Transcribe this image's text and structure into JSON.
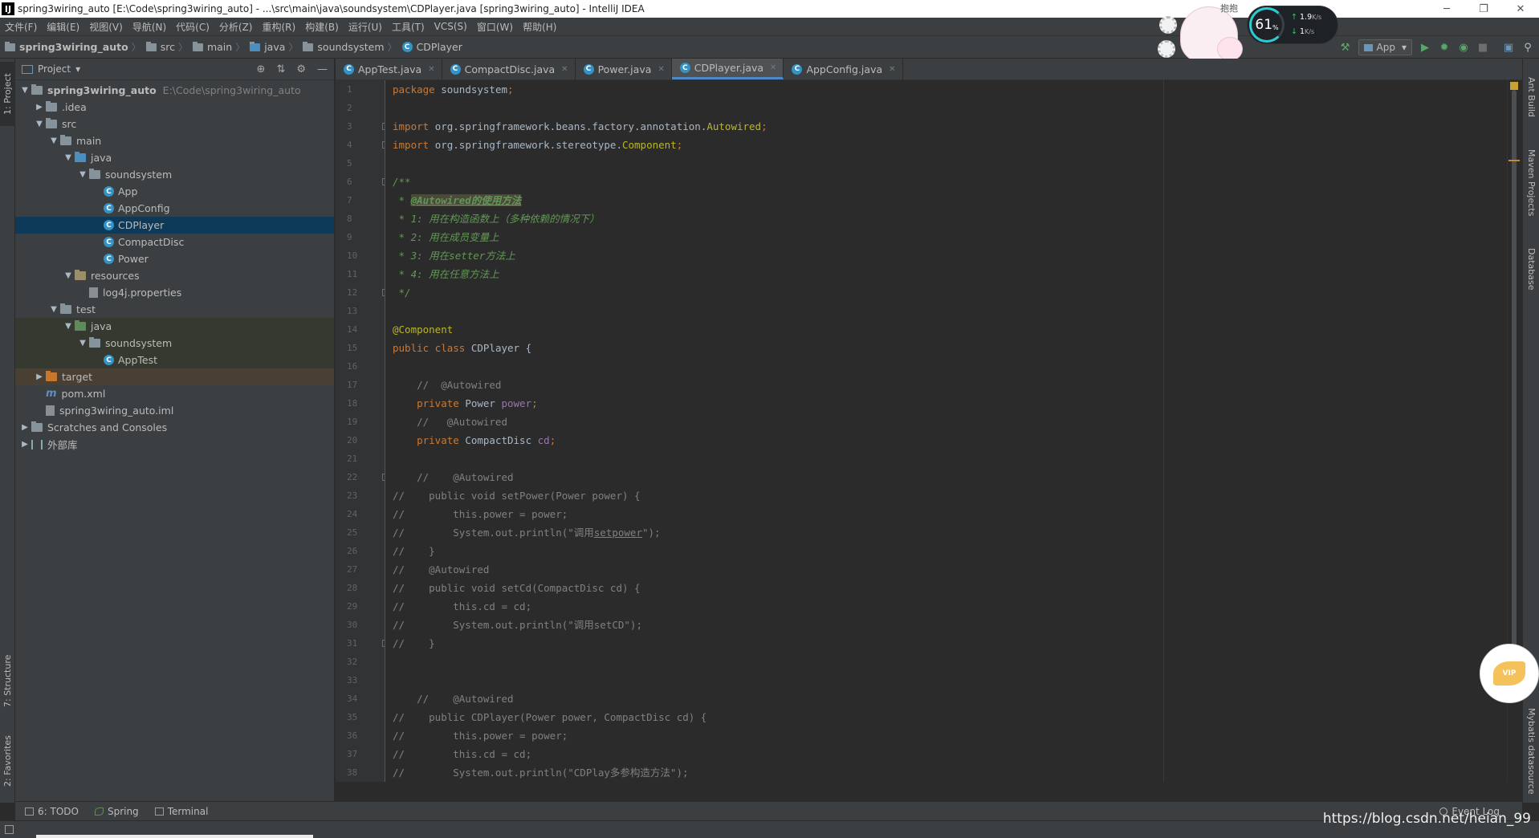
{
  "window": {
    "app_icon": "IJ",
    "title": "spring3wiring_auto [E:\\Code\\spring3wiring_auto] - ...\\src\\main\\java\\soundsystem\\CDPlayer.java [spring3wiring_auto] - IntelliJ IDEA",
    "minimize": "─",
    "restore": "❐",
    "close": "✕"
  },
  "menu": [
    "文件(F)",
    "编辑(E)",
    "视图(V)",
    "导航(N)",
    "代码(C)",
    "分析(Z)",
    "重构(R)",
    "构建(B)",
    "运行(U)",
    "工具(T)",
    "VCS(S)",
    "窗口(W)",
    "帮助(H)"
  ],
  "breadcrumbs": {
    "project": "spring3wiring_auto",
    "src": "src",
    "main": "main",
    "java": "java",
    "package": "soundsystem",
    "class": "CDPlayer",
    "sep": "〉",
    "class_icon": "C"
  },
  "toolbar": {
    "run_config": "App",
    "run_config_arrow": "▾",
    "build_icon": "hammer-icon",
    "run_icon": "▶",
    "debug_icon": "✹",
    "coverage_icon": "◉",
    "stop_icon": "■",
    "structure_icon": "▣",
    "search_icon": "⚲"
  },
  "overlay": {
    "mascot_label": "抱抱",
    "cpu_percent": "61",
    "cpu_unit": "%",
    "upload": "1.9",
    "upload_unit": "K/s",
    "download": "1",
    "download_unit": "K/s",
    "up_arrow": "↑",
    "down_arrow": "↓"
  },
  "left_strip": {
    "project_tab": "1: Project",
    "structure_tab": "7: Structure",
    "favorites_tab": "2: Favorites"
  },
  "right_strip": {
    "ant_build": "Ant Build",
    "maven": "Maven Projects",
    "database": "Database",
    "mybatis": "Mybatis datasource"
  },
  "project_panel": {
    "title": "Project",
    "title_arrow": "▾",
    "tools": [
      "⊕",
      "⇅",
      "⚙",
      "—"
    ],
    "tree": [
      {
        "label": "spring3wiring_auto",
        "path": "E:\\Code\\spring3wiring_auto",
        "depth": 0,
        "arrow": "▼",
        "icon": "module",
        "bold": true
      },
      {
        "label": ".idea",
        "depth": 1,
        "arrow": "▶",
        "icon": "folder"
      },
      {
        "label": "src",
        "depth": 1,
        "arrow": "▼",
        "icon": "folder"
      },
      {
        "label": "main",
        "depth": 2,
        "arrow": "▼",
        "icon": "folder"
      },
      {
        "label": "java",
        "depth": 3,
        "arrow": "▼",
        "icon": "src"
      },
      {
        "label": "soundsystem",
        "depth": 4,
        "arrow": "▼",
        "icon": "package"
      },
      {
        "label": "App",
        "depth": 5,
        "icon": "class"
      },
      {
        "label": "AppConfig",
        "depth": 5,
        "icon": "class"
      },
      {
        "label": "CDPlayer",
        "depth": 5,
        "icon": "class",
        "selected": true
      },
      {
        "label": "CompactDisc",
        "depth": 5,
        "icon": "class"
      },
      {
        "label": "Power",
        "depth": 5,
        "icon": "class"
      },
      {
        "label": "resources",
        "depth": 3,
        "arrow": "▼",
        "icon": "res"
      },
      {
        "label": "log4j.properties",
        "depth": 4,
        "icon": "file"
      },
      {
        "label": "test",
        "depth": 2,
        "arrow": "▼",
        "icon": "folder"
      },
      {
        "label": "java",
        "depth": 3,
        "arrow": "▼",
        "icon": "test",
        "tint": true
      },
      {
        "label": "soundsystem",
        "depth": 4,
        "arrow": "▼",
        "icon": "package",
        "tint": true
      },
      {
        "label": "AppTest",
        "depth": 5,
        "icon": "class",
        "tint": true
      },
      {
        "label": "target",
        "depth": 1,
        "arrow": "▶",
        "icon": "target",
        "excluded": true
      },
      {
        "label": "pom.xml",
        "depth": 1,
        "icon": "maven"
      },
      {
        "label": "spring3wiring_auto.iml",
        "depth": 1,
        "icon": "file"
      },
      {
        "label": "Scratches and Consoles",
        "depth": 0,
        "arrow": "▶",
        "icon": "folder"
      },
      {
        "label": "外部库",
        "depth": 0,
        "arrow": "▶",
        "icon": "lib"
      }
    ]
  },
  "editor_tabs": [
    {
      "label": "AppTest.java",
      "active": false
    },
    {
      "label": "CompactDisc.java",
      "active": false
    },
    {
      "label": "Power.java",
      "active": false
    },
    {
      "label": "CDPlayer.java",
      "active": true
    },
    {
      "label": "AppConfig.java",
      "active": false
    }
  ],
  "tab_close": "✕",
  "code_lines": [
    [
      {
        "t": "package ",
        "c": "kw"
      },
      {
        "t": "soundsystem"
      },
      {
        "t": ";",
        "c": "kw"
      }
    ],
    [],
    [
      {
        "t": "import ",
        "c": "kw"
      },
      {
        "t": "org.springframework.beans.factory.annotation."
      },
      {
        "t": "Autowired",
        "c": "an"
      },
      {
        "t": ";",
        "c": "kw"
      }
    ],
    [
      {
        "t": "import ",
        "c": "kw"
      },
      {
        "t": "org.springframework.stereotype."
      },
      {
        "t": "Component",
        "c": "an"
      },
      {
        "t": ";",
        "c": "kw"
      }
    ],
    [],
    [
      {
        "t": "/**",
        "c": "doc"
      }
    ],
    [
      {
        "t": " * ",
        "c": "doc"
      },
      {
        "t": "@Autowired",
        "c": "doctag"
      },
      {
        "t": "的使用方法",
        "c": "doctag"
      }
    ],
    [
      {
        "t": " * 1: ",
        "c": "doc"
      },
      {
        "t": "用在构造函数上（多种依赖的情况下）",
        "c": "doc"
      }
    ],
    [
      {
        "t": " * 2: ",
        "c": "doc"
      },
      {
        "t": "用在成员变量上",
        "c": "doc"
      }
    ],
    [
      {
        "t": " * 3: ",
        "c": "doc"
      },
      {
        "t": "用在",
        "c": "doc"
      },
      {
        "t": "setter",
        "c": "doc"
      },
      {
        "t": "方法上",
        "c": "doc"
      }
    ],
    [
      {
        "t": " * 4: ",
        "c": "doc"
      },
      {
        "t": "用在任意方法上",
        "c": "doc"
      }
    ],
    [
      {
        "t": " */",
        "c": "doc"
      }
    ],
    [],
    [
      {
        "t": "@Component",
        "c": "an"
      }
    ],
    [
      {
        "t": "public class ",
        "c": "kw"
      },
      {
        "t": "CDPlayer {"
      }
    ],
    [],
    [
      {
        "t": "    //  @Autowired",
        "c": "cm"
      }
    ],
    [
      {
        "t": "    private ",
        "c": "kw"
      },
      {
        "t": "Power "
      },
      {
        "t": "power",
        "c": "fld"
      },
      {
        "t": ";",
        "c": "kw"
      }
    ],
    [
      {
        "t": "    //   @Autowired",
        "c": "cm"
      }
    ],
    [
      {
        "t": "    private ",
        "c": "kw"
      },
      {
        "t": "CompactDisc "
      },
      {
        "t": "cd",
        "c": "fld"
      },
      {
        "t": ";",
        "c": "kw"
      }
    ],
    [],
    [
      {
        "t": "    //    @Autowired",
        "c": "cm"
      }
    ],
    [
      {
        "t": "//    public void setPower(Power power) {",
        "c": "cm"
      }
    ],
    [
      {
        "t": "//        this.power = power;",
        "c": "cm"
      }
    ],
    [
      {
        "t": "//        System.out.println(\"调用",
        "c": "cm"
      },
      {
        "t": "setpower",
        "c": "cm ul"
      },
      {
        "t": "\");",
        "c": "cm"
      }
    ],
    [
      {
        "t": "//    }",
        "c": "cm"
      }
    ],
    [
      {
        "t": "//    @Autowired",
        "c": "cm"
      }
    ],
    [
      {
        "t": "//    public void setCd(CompactDisc cd) {",
        "c": "cm"
      }
    ],
    [
      {
        "t": "//        this.cd = cd;",
        "c": "cm"
      }
    ],
    [
      {
        "t": "//        System.out.println(\"调用setCD\");",
        "c": "cm"
      }
    ],
    [
      {
        "t": "//    }",
        "c": "cm"
      }
    ],
    [],
    [],
    [
      {
        "t": "    //    @Autowired",
        "c": "cm"
      }
    ],
    [
      {
        "t": "//    public CDPlayer(Power power, CompactDisc cd) {",
        "c": "cm"
      }
    ],
    [
      {
        "t": "//        this.power = power;",
        "c": "cm"
      }
    ],
    [
      {
        "t": "//        this.cd = cd;",
        "c": "cm"
      }
    ],
    [
      {
        "t": "//        System.out.println(\"CDPlay多参构造方法\");",
        "c": "cm"
      }
    ]
  ],
  "bottom_tools": [
    {
      "label": "6: TODO",
      "icon": "list-icon"
    },
    {
      "label": "Spring",
      "icon": "spring-leaf-icon"
    },
    {
      "label": "Terminal",
      "icon": "terminal-icon"
    }
  ],
  "event_log": "Event Log",
  "watermark": "https://blog.csdn.net/heian_99",
  "vip_badge": "VIP",
  "colors": {
    "background": "#2b2b2b",
    "panel": "#3c3f41",
    "selection": "#0d3a58",
    "keyword": "#cc7832",
    "annotation": "#bbb529",
    "comment": "#808080",
    "doc_comment": "#629755",
    "field": "#9876aa",
    "accent": "#4a88c7"
  }
}
